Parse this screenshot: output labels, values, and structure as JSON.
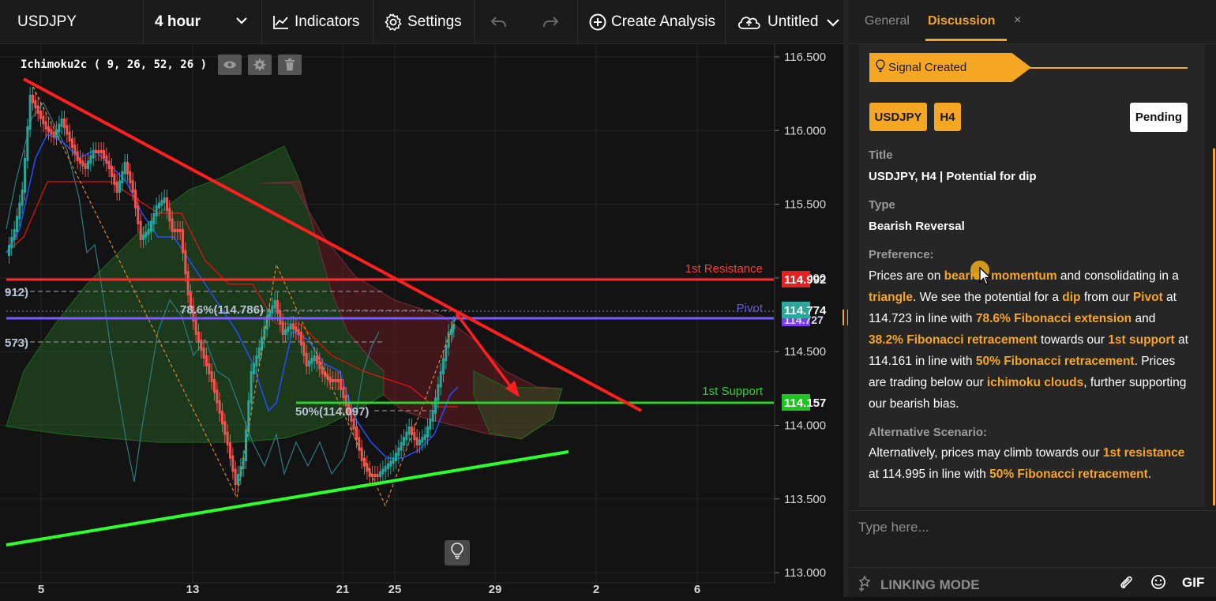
{
  "toolbar": {
    "symbol": "USDJPY",
    "timeframe": "4 hour",
    "indicators_label": "Indicators",
    "settings_label": "Settings",
    "create_analysis_label": "Create Analysis",
    "untitled_label": "Untitled"
  },
  "indicator": {
    "label": "Ichimoku2c ( 9, 26, 52, 26 )"
  },
  "chart": {
    "price_axis": [
      "116.500",
      "116.000",
      "115.500",
      "115.000",
      "114.500",
      "114.000",
      "113.500",
      "113.000"
    ],
    "date_axis": [
      "5",
      "13",
      "21",
      "25",
      "29",
      "2",
      "6"
    ],
    "price_tags": {
      "resistance": "114.992",
      "pivot_price": "114.774",
      "pivot_under": "114.727",
      "support": "114.157"
    },
    "level_labels": {
      "resistance": "1st Resistance",
      "pivot": "Pivot",
      "support": "1st Support"
    },
    "fib_labels": {
      "fib_786": "78.6%(114.786)",
      "fib_50": "50%(114.097)",
      "left_912": "912)",
      "left_573": "573)"
    },
    "colors": {
      "resistance": "#ff2b2b",
      "pivot": "#7a5cff",
      "support": "#2ed12e",
      "trendline_down": "#ff1f1f",
      "trendline_up": "#2cff2c",
      "bull_candle": "#26a69a",
      "bear_candle": "#ef5350"
    }
  },
  "panel": {
    "tabs": [
      {
        "label": "General"
      },
      {
        "label": "Discussion"
      }
    ],
    "close_glyph": "×",
    "signal_label": "Signal Created",
    "tags": [
      "USDJPY",
      "H4"
    ],
    "status": "Pending",
    "title_label": "Title",
    "title_value": "USDJPY, H4 | Potential for dip",
    "type_label": "Type",
    "type_value": "Bearish Reversal",
    "preference_label": "Preference:",
    "preference": [
      {
        "t": "Prices are on ",
        "h": false
      },
      {
        "t": "bearish momentum",
        "h": true
      },
      {
        "t": " and consolidating in a ",
        "h": false
      },
      {
        "t": "triangle",
        "h": true
      },
      {
        "t": ". We see the potential for a ",
        "h": false
      },
      {
        "t": "dip",
        "h": true
      },
      {
        "t": " from our ",
        "h": false
      },
      {
        "t": "Pivot",
        "h": true
      },
      {
        "t": " at 114.723 in line with ",
        "h": false
      },
      {
        "t": "78.6% Fibonacci extension",
        "h": true
      },
      {
        "t": " and ",
        "h": false
      },
      {
        "t": "38.2% Fibonacci retracement",
        "h": true
      },
      {
        "t": " towards our ",
        "h": false
      },
      {
        "t": "1st support",
        "h": true
      },
      {
        "t": " at 114.161 in line with ",
        "h": false
      },
      {
        "t": "50% Fibonacci retracement",
        "h": true
      },
      {
        "t": ". Prices are trading below our ",
        "h": false
      },
      {
        "t": "ichimoku clouds",
        "h": true
      },
      {
        "t": ", further supporting our bearish bias.",
        "h": false
      }
    ],
    "alternative_label": "Alternative Scenario:",
    "alternative": [
      {
        "t": "Alternatively, prices may climb towards our ",
        "h": false
      },
      {
        "t": "1st resistance",
        "h": true
      },
      {
        "t": " at 114.995 in line with ",
        "h": false
      },
      {
        "t": "50% Fibonacci retracement",
        "h": true
      },
      {
        "t": ".",
        "h": false
      }
    ],
    "input_placeholder": "Type here...",
    "linking_mode_label": "LINKING MODE",
    "gif_label": "GIF"
  },
  "icons": [
    "chevron-down-icon",
    "indicators-chart-icon",
    "gear-icon",
    "undo-icon",
    "redo-icon",
    "plus-circle-icon",
    "cloud-upload-icon",
    "eye-icon",
    "trash-icon",
    "lightbulb-icon",
    "paperclip-icon",
    "emoji-icon",
    "linking-mode-icon"
  ]
}
